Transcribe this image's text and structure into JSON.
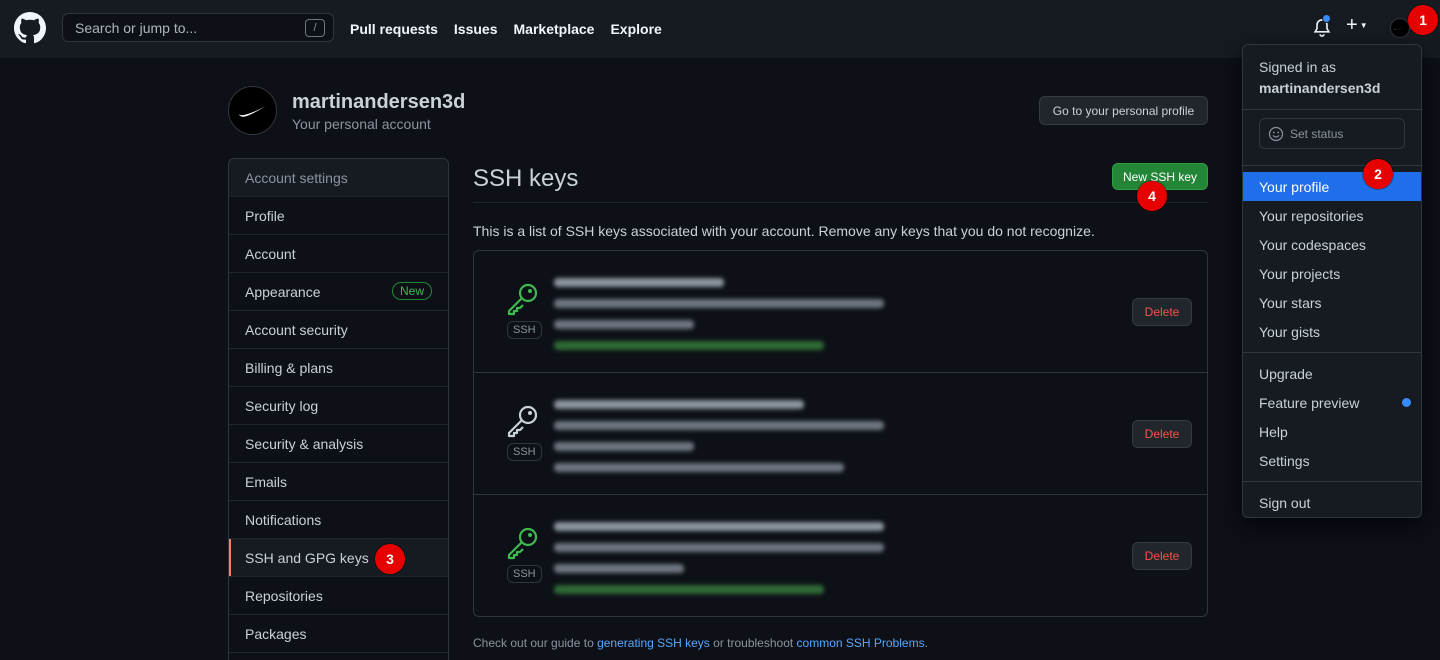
{
  "header": {
    "search_placeholder": "Search or jump to...",
    "slash_key": "/",
    "nav": [
      "Pull requests",
      "Issues",
      "Marketplace",
      "Explore"
    ],
    "plus_label": "+"
  },
  "badges": [
    "1",
    "2",
    "3",
    "4"
  ],
  "profile": {
    "username": "martinandersen3d",
    "subtitle": "Your personal account",
    "go_profile_button": "Go to your personal profile"
  },
  "sidebar": {
    "heading": "Account settings",
    "items": [
      {
        "label": "Profile"
      },
      {
        "label": "Account"
      },
      {
        "label": "Appearance",
        "badge": "New"
      },
      {
        "label": "Account security"
      },
      {
        "label": "Billing & plans"
      },
      {
        "label": "Security log"
      },
      {
        "label": "Security & analysis"
      },
      {
        "label": "Emails"
      },
      {
        "label": "Notifications"
      },
      {
        "label": "SSH and GPG keys",
        "active": true
      },
      {
        "label": "Repositories"
      },
      {
        "label": "Packages"
      }
    ]
  },
  "main": {
    "title": "SSH keys",
    "new_key_button": "New SSH key",
    "description": "This is a list of SSH keys associated with your account. Remove any keys that you do not recognize.",
    "ssh_tag": "SSH",
    "delete_label": "Delete",
    "footer": {
      "prefix": "Check out our guide to ",
      "link1": "generating SSH keys",
      "middle": " or troubleshoot ",
      "link2": "common SSH Problems",
      "suffix": "."
    }
  },
  "dropdown": {
    "signed_in_as": "Signed in as",
    "username": "martinandersen3d",
    "set_status": "Set status",
    "group1": [
      "Your profile",
      "Your repositories",
      "Your codespaces",
      "Your projects",
      "Your stars",
      "Your gists"
    ],
    "group2": [
      "Upgrade",
      "Feature preview",
      "Help",
      "Settings"
    ],
    "sign_out": "Sign out"
  },
  "colors": {
    "accent_green": "#238636",
    "active_blue": "#1f6feb",
    "danger": "#f85149",
    "key_green": "#3fb950",
    "badge_red": "#e60000"
  }
}
